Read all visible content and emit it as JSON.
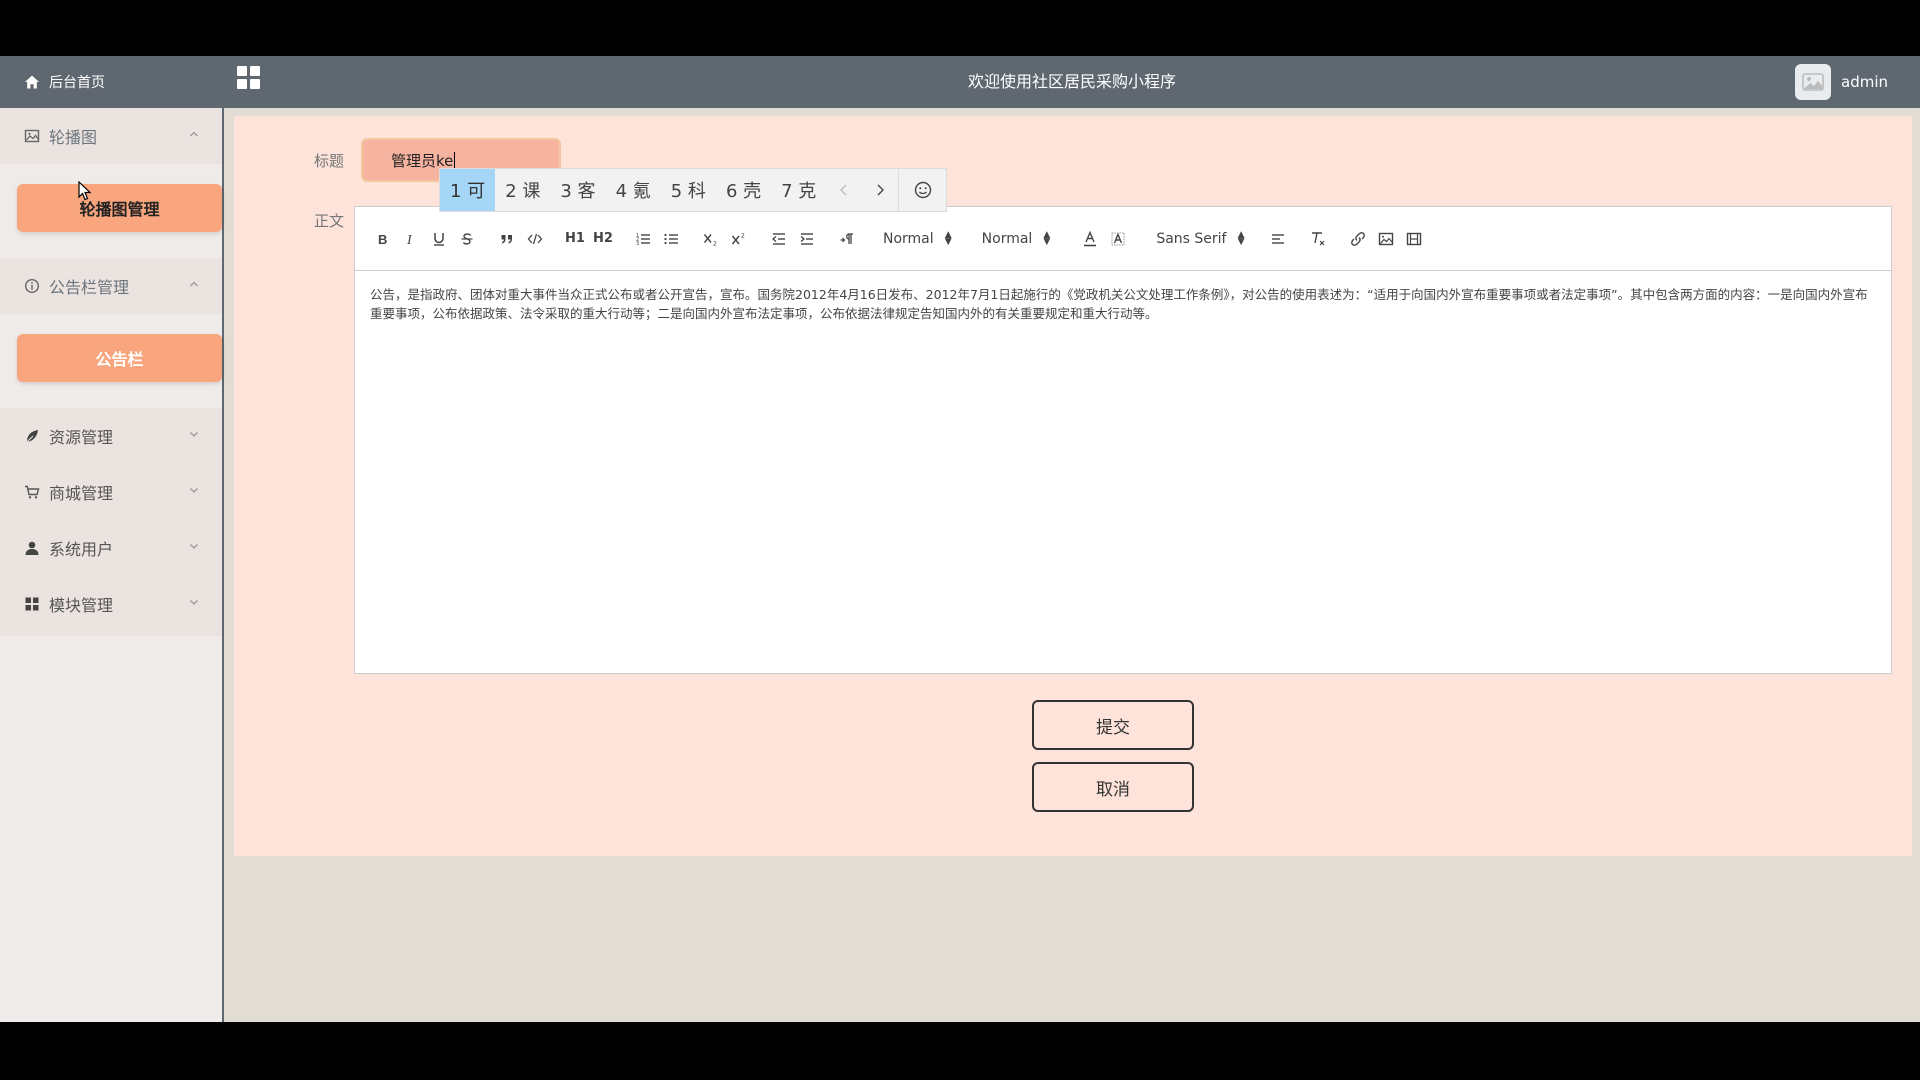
{
  "header": {
    "home_label": "后台首页",
    "title": "欢迎使用社区居民采购小程序",
    "username": "admin"
  },
  "sidebar": {
    "groups": [
      {
        "label": "轮播图",
        "expanded": true,
        "sub_label": "轮播图管理"
      },
      {
        "label": "公告栏管理",
        "expanded": true,
        "sub_label": "公告栏"
      }
    ],
    "items": [
      {
        "label": "资源管理"
      },
      {
        "label": "商城管理"
      },
      {
        "label": "系统用户"
      },
      {
        "label": "模块管理"
      }
    ]
  },
  "form": {
    "title_label": "标题",
    "title_value": "管理员ke",
    "body_label": "正文",
    "ime_candidates": [
      "1 可",
      "2 课",
      "3 客",
      "4 氪",
      "5 科",
      "6 壳",
      "7 克"
    ],
    "toolbar": {
      "h1": "H1",
      "h2": "H2",
      "header_picker": "Normal",
      "size_picker": "Normal",
      "font_picker": "Sans Serif"
    },
    "body_text": "公告，是指政府、团体对重大事件当众正式公布或者公开宣告，宣布。国务院2012年4月16日发布、2012年7月1日起施行的《党政机关公文处理工作条例》，对公告的使用表述为：“适用于向国内外宣布重要事项或者法定事项”。其中包含两方面的内容：一是向国内外宣布重要事项，公布依据政策、法令采取的重大行动等；二是向国内外宣布法定事项，公布依据法律规定告知国内外的有关重要规定和重大行动等。",
    "submit_label": "提交",
    "cancel_label": "取消"
  },
  "colors": {
    "header_bg": "#5f6770",
    "accent": "#f9a57e",
    "main_bg": "#fde3da",
    "ime_selected": "#a6d6f5"
  }
}
